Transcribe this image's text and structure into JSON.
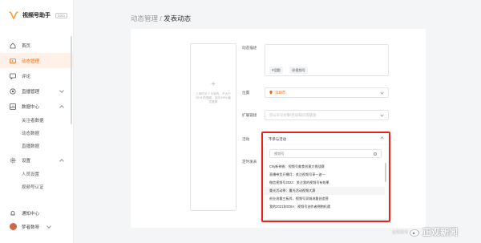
{
  "brand": {
    "name": "视频号助手",
    "badge": "beta"
  },
  "sidebar": {
    "items": [
      {
        "label": "首页",
        "icon": "home-icon"
      },
      {
        "label": "动态管理",
        "icon": "video-icon",
        "active": true
      },
      {
        "label": "评论",
        "icon": "comment-icon"
      },
      {
        "label": "直播管理",
        "icon": "live-icon"
      },
      {
        "label": "数据中心",
        "icon": "chart-icon"
      }
    ],
    "data_sub": [
      "关注者数据",
      "动态数据",
      "直播数据"
    ],
    "settings": {
      "label": "设置",
      "icon": "gear-icon"
    },
    "settings_sub": [
      "人员设置",
      "视频号认证"
    ],
    "notify": "通知中心",
    "account": "梦者数呀"
  },
  "breadcrumb": {
    "parent": "动态管理",
    "separator": " / ",
    "current": "发表动态"
  },
  "upload": {
    "tip": "上传时长 1 分钟内、不大于 20 M 的视频，支持 MP4 格式推荐"
  },
  "form": {
    "desc_label": "动态描述",
    "tags": [
      "#话题",
      "@视频号"
    ],
    "location_label": "位置",
    "location_value": "深圳市",
    "link_label": "扩展链接",
    "link_placeholder": "仅公众号文章/活动/知识等链接",
    "activity_label": "活动",
    "activity_value": "不参与活动",
    "time_label": "定时发表"
  },
  "dropdown": {
    "search_value": "视频号",
    "items": [
      "CIty新神香：视频号美食创意大挑战赛",
      "直播带货开播月：关注视频号享一波—",
      "微信视频号2022：关注我的视频号有效果",
      "重光活动季：重光活动视频大赛",
      "创业流量三板斧，视频号双城流量创造营",
      "我的2021年EDIA：视频号创作者拥抱机遇"
    ]
  },
  "watermark": {
    "text": "正观新闻",
    "small": "@搜狐号"
  }
}
